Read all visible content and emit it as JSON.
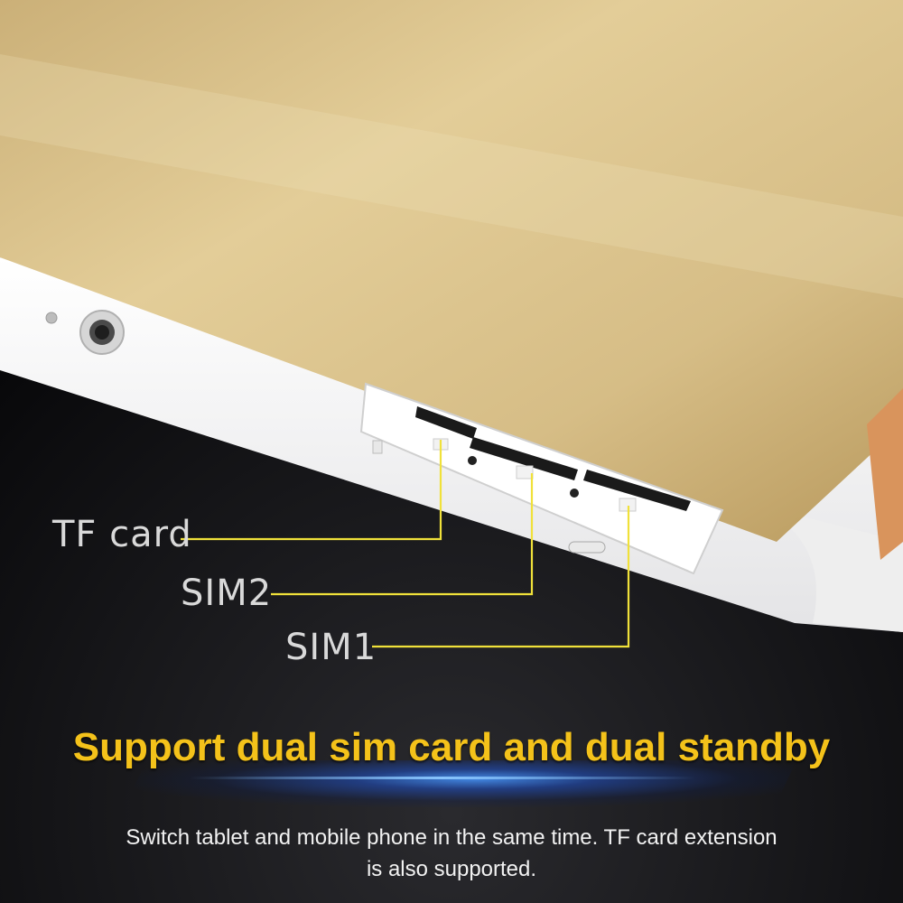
{
  "labels": {
    "tf_card": "TF card",
    "sim2": "SIM2",
    "sim1": "SIM1"
  },
  "headline": "Support dual sim card and dual standby",
  "description": {
    "line1": "Switch tablet and mobile phone in the same time. TF card extension",
    "line2": "is also supported."
  },
  "colors": {
    "headline": "#f4c21a",
    "callout_line": "#f0e13a",
    "tablet_back": "#d8c08a",
    "tablet_frame": "#f6f6f6",
    "background": "#0d0d0f"
  }
}
